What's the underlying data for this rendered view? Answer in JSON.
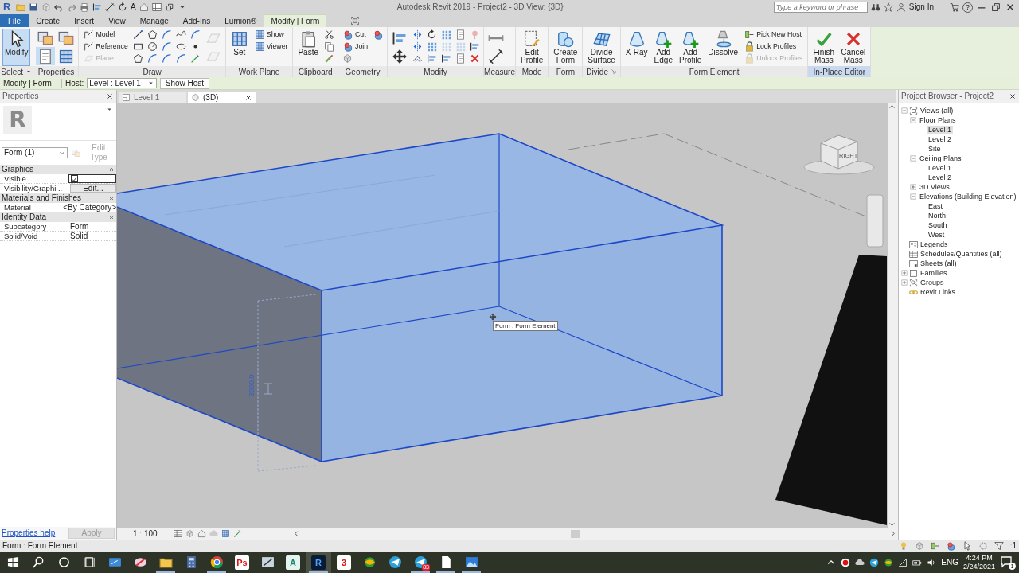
{
  "title_bar": {
    "logo": "R",
    "quick_access_letter": "A",
    "title": "Autodesk Revit 2019 - Project2 - 3D View: {3D}",
    "search": {
      "placeholder": "Type a keyword or phrase"
    },
    "sign_in": "Sign In",
    "help": "?"
  },
  "ribbon_tabs": [
    {
      "label": "File",
      "kind": "file",
      "selected": false
    },
    {
      "label": "Create",
      "kind": "tab",
      "selected": false
    },
    {
      "label": "Insert",
      "kind": "tab",
      "selected": false
    },
    {
      "label": "View",
      "kind": "tab",
      "selected": false
    },
    {
      "label": "Manage",
      "kind": "tab",
      "selected": false
    },
    {
      "label": "Add-Ins",
      "kind": "tab",
      "selected": false
    },
    {
      "label": "Lumion®",
      "kind": "tab",
      "selected": false
    },
    {
      "label": "Modify | Form",
      "kind": "contextual",
      "selected": true
    }
  ],
  "ribbon_panels": [
    {
      "title": "Select",
      "menu": true,
      "launcher": false,
      "highlight": false,
      "tools": [
        {
          "kind": "large",
          "label": "Modify",
          "selected": true,
          "disabled": false
        }
      ]
    },
    {
      "title": "Properties",
      "menu": false,
      "launcher": false,
      "highlight": false,
      "tools": [
        {
          "kind": "medium",
          "selected": false,
          "disabled": false
        },
        {
          "kind": "medium",
          "selected": true,
          "disabled": false
        },
        {
          "kind": "medium",
          "selected": false,
          "disabled": false
        },
        {
          "kind": "medium",
          "selected": false,
          "disabled": false
        }
      ]
    },
    {
      "title": "Draw",
      "menu": false,
      "launcher": false,
      "highlight": false,
      "tools": [
        {
          "kind": "small",
          "label": "Model",
          "selected": false,
          "disabled": false
        },
        {
          "kind": "small",
          "label": "Reference",
          "selected": false,
          "disabled": false
        },
        {
          "kind": "small",
          "label": "Plane",
          "selected": false,
          "disabled": true
        },
        {
          "kind": "icon",
          "selected": false,
          "disabled": false
        },
        {
          "kind": "icon",
          "selected": false,
          "disabled": false
        },
        {
          "kind": "icon",
          "selected": false,
          "disabled": false
        },
        {
          "kind": "icon",
          "selected": false,
          "disabled": false
        },
        {
          "kind": "icon",
          "selected": false,
          "disabled": false
        },
        {
          "kind": "icon",
          "selected": false,
          "disabled": false
        },
        {
          "kind": "icon",
          "selected": false,
          "disabled": false
        },
        {
          "kind": "icon",
          "selected": false,
          "disabled": false
        },
        {
          "kind": "icon",
          "selected": false,
          "disabled": false
        },
        {
          "kind": "icon",
          "selected": false,
          "disabled": false
        },
        {
          "kind": "icon",
          "selected": false,
          "disabled": false
        },
        {
          "kind": "icon",
          "selected": false,
          "disabled": false
        },
        {
          "kind": "icon",
          "selected": false,
          "disabled": false
        },
        {
          "kind": "icon",
          "selected": false,
          "disabled": false
        },
        {
          "kind": "icon",
          "selected": false,
          "disabled": false
        },
        {
          "kind": "medium",
          "selected": false,
          "disabled": true
        },
        {
          "kind": "medium",
          "selected": false,
          "disabled": true
        }
      ]
    },
    {
      "title": "Work Plane",
      "menu": false,
      "launcher": false,
      "highlight": false,
      "tools": [
        {
          "kind": "large",
          "label": "Set",
          "selected": false,
          "disabled": false
        },
        {
          "kind": "small",
          "label": "Show",
          "selected": false,
          "disabled": false
        },
        {
          "kind": "small",
          "label": "Viewer",
          "selected": false,
          "disabled": false
        }
      ]
    },
    {
      "title": "Clipboard",
      "menu": false,
      "launcher": false,
      "highlight": false,
      "tools": [
        {
          "kind": "large",
          "label": "Paste",
          "selected": false,
          "disabled": false
        },
        {
          "kind": "icon",
          "selected": false,
          "disabled": false
        },
        {
          "kind": "icon",
          "selected": false,
          "disabled": false
        },
        {
          "kind": "icon",
          "selected": false,
          "disabled": false
        }
      ]
    },
    {
      "title": "Geometry",
      "menu": false,
      "launcher": false,
      "highlight": false,
      "tools": [
        {
          "kind": "small",
          "label": "Cut",
          "selected": false,
          "disabled": false
        },
        {
          "kind": "small",
          "label": "Join",
          "selected": false,
          "disabled": false
        },
        {
          "kind": "icon",
          "selected": false,
          "disabled": false
        },
        {
          "kind": "icon",
          "selected": false,
          "disabled": false
        }
      ]
    },
    {
      "title": "Modify",
      "menu": false,
      "launcher": false,
      "highlight": false,
      "tools": [
        {
          "kind": "medium",
          "selected": false,
          "disabled": false
        },
        {
          "kind": "medium",
          "selected": false,
          "disabled": false
        },
        {
          "kind": "icon",
          "selected": false,
          "disabled": false
        },
        {
          "kind": "icon",
          "selected": false,
          "disabled": false
        },
        {
          "kind": "icon",
          "selected": false,
          "disabled": false
        },
        {
          "kind": "icon",
          "selected": false,
          "disabled": false
        },
        {
          "kind": "icon",
          "selected": false,
          "disabled": false
        },
        {
          "kind": "icon",
          "selected": false,
          "disabled": false
        },
        {
          "kind": "icon",
          "selected": false,
          "disabled": false
        },
        {
          "kind": "icon",
          "selected": false,
          "disabled": true
        },
        {
          "kind": "icon",
          "selected": false,
          "disabled": false
        },
        {
          "kind": "icon",
          "selected": false,
          "disabled": false
        },
        {
          "kind": "icon",
          "selected": false,
          "disabled": true
        },
        {
          "kind": "icon",
          "selected": false,
          "disabled": false
        },
        {
          "kind": "icon",
          "selected": false,
          "disabled": true
        },
        {
          "kind": "icon",
          "selected": false,
          "disabled": false
        },
        {
          "kind": "icon",
          "selected": false,
          "disabled": false
        }
      ]
    },
    {
      "title": "Measure",
      "menu": false,
      "launcher": false,
      "highlight": false,
      "tools": [
        {
          "kind": "medium",
          "selected": false,
          "disabled": false
        },
        {
          "kind": "medium",
          "selected": false,
          "disabled": false
        }
      ]
    },
    {
      "title": "Mode",
      "menu": false,
      "launcher": false,
      "highlight": false,
      "tools": [
        {
          "kind": "large",
          "label": "Edit Profile",
          "selected": false,
          "disabled": false
        }
      ]
    },
    {
      "title": "Form",
      "menu": false,
      "launcher": false,
      "highlight": false,
      "tools": [
        {
          "kind": "large",
          "label": "Create Form",
          "selected": false,
          "disabled": false
        }
      ]
    },
    {
      "title": "Divide",
      "menu": false,
      "launcher": true,
      "highlight": false,
      "tools": [
        {
          "kind": "large",
          "label": "Divide Surface",
          "selected": false,
          "disabled": false
        }
      ]
    },
    {
      "title": "Form Element",
      "menu": false,
      "launcher": false,
      "highlight": false,
      "tools": [
        {
          "kind": "large",
          "label": "X-Ray",
          "selected": false,
          "disabled": false
        },
        {
          "kind": "large",
          "label": "Add Edge",
          "selected": false,
          "disabled": false
        },
        {
          "kind": "large",
          "label": "Add Profile",
          "selected": false,
          "disabled": false
        },
        {
          "kind": "large",
          "label": "Dissolve",
          "selected": false,
          "disabled": false
        },
        {
          "kind": "small",
          "label": "Pick New Host",
          "selected": false,
          "disabled": false
        },
        {
          "kind": "small",
          "label": "Lock Profiles",
          "selected": false,
          "disabled": false
        },
        {
          "kind": "small",
          "label": "Unlock Profiles",
          "selected": false,
          "disabled": true
        }
      ]
    },
    {
      "title": "In-Place Editor",
      "menu": false,
      "launcher": false,
      "highlight": true,
      "tools": [
        {
          "kind": "large",
          "label": "Finish Mass",
          "selected": false,
          "disabled": false
        },
        {
          "kind": "large",
          "label": "Cancel Mass",
          "selected": false,
          "disabled": false
        }
      ]
    }
  ],
  "options_bar": {
    "context": "Modify | Form",
    "host_label": "Host:",
    "host_value": "Level : Level 1",
    "show_host": "Show Host"
  },
  "properties": {
    "title": "Properties",
    "type_preview": "R",
    "type_selector": "Form (1)",
    "edit_type": {
      "label": "Edit Type",
      "disabled": true
    },
    "groups": [
      {
        "title": "Graphics",
        "expanded": true,
        "rows": [
          {
            "name": "Visible",
            "kind": "checkbox",
            "checked": true
          },
          {
            "name": "Visibility/Graphi...",
            "kind": "button",
            "value": "Edit..."
          }
        ]
      },
      {
        "title": "Materials and Finishes",
        "expanded": true,
        "rows": [
          {
            "name": "Material",
            "kind": "text",
            "value": "<By Category>"
          }
        ]
      },
      {
        "title": "Identity Data",
        "expanded": true,
        "rows": [
          {
            "name": "Subcategory",
            "kind": "text",
            "value": "Form"
          },
          {
            "name": "Solid/Void",
            "kind": "text",
            "value": "Solid"
          }
        ]
      }
    ],
    "help_link": "Properties help",
    "apply": {
      "label": "Apply",
      "disabled": true
    }
  },
  "view_tabs": [
    {
      "label": "Level 1",
      "selected": false
    },
    {
      "label": "(3D)",
      "selected": true
    }
  ],
  "viewport": {
    "tooltip": "Form : Form Element",
    "dimension": "3000.0",
    "view_cube_face": "RIGHT",
    "scale": "1 : 100"
  },
  "project_browser": {
    "title": "Project Browser - Project2",
    "tree": [
      {
        "label": "Views (all)",
        "kind": "views",
        "expanded": true,
        "selected": false,
        "children": [
          {
            "label": "Floor Plans",
            "expanded": true,
            "selected": false,
            "children": [
              {
                "label": "Level 1",
                "selected": true
              },
              {
                "label": "Level 2",
                "selected": false
              },
              {
                "label": "Site",
                "selected": false
              }
            ]
          },
          {
            "label": "Ceiling Plans",
            "expanded": true,
            "selected": false,
            "children": [
              {
                "label": "Level 1",
                "selected": false
              },
              {
                "label": "Level 2",
                "selected": false
              }
            ]
          },
          {
            "label": "3D Views",
            "expanded": false,
            "selected": false
          },
          {
            "label": "Elevations (Building Elevation)",
            "expanded": true,
            "selected": false,
            "children": [
              {
                "label": "East",
                "selected": false
              },
              {
                "label": "North",
                "selected": false
              },
              {
                "label": "South",
                "selected": false
              },
              {
                "label": "West",
                "selected": false
              }
            ]
          }
        ]
      },
      {
        "label": "Legends",
        "kind": "legends",
        "selected": false
      },
      {
        "label": "Schedules/Quantities (all)",
        "kind": "schedules",
        "selected": false
      },
      {
        "label": "Sheets (all)",
        "kind": "sheets",
        "selected": false
      },
      {
        "label": "Families",
        "kind": "families",
        "expanded": false,
        "selected": false
      },
      {
        "label": "Groups",
        "kind": "groups",
        "expanded": false,
        "selected": false
      },
      {
        "label": "Revit Links",
        "kind": "links",
        "selected": false
      }
    ]
  },
  "status_bar": {
    "text": "Form : Form Element",
    "filter_count": ":1"
  },
  "taskbar": {
    "apps": [
      {
        "running": false,
        "selected": false
      },
      {
        "running": false,
        "selected": false
      },
      {
        "running": true,
        "selected": false
      },
      {
        "running": false,
        "selected": false
      },
      {
        "running": true,
        "selected": false
      },
      {
        "glyph": "Ps",
        "running": false,
        "selected": false
      },
      {
        "running": false,
        "selected": false
      },
      {
        "glyph": "A",
        "running": false,
        "selected": false
      },
      {
        "glyph": "R",
        "running": true,
        "selected": true
      },
      {
        "glyph": "3",
        "running": false,
        "selected": false
      },
      {
        "running": false,
        "selected": false
      },
      {
        "running": false,
        "selected": false
      },
      {
        "badge": "83",
        "running": true,
        "selected": false
      },
      {
        "running": true,
        "selected": false
      },
      {
        "running": true,
        "selected": false
      }
    ],
    "language": "ENG",
    "time": "4:24 PM",
    "date": "2/24/2021",
    "notifications": "1"
  }
}
